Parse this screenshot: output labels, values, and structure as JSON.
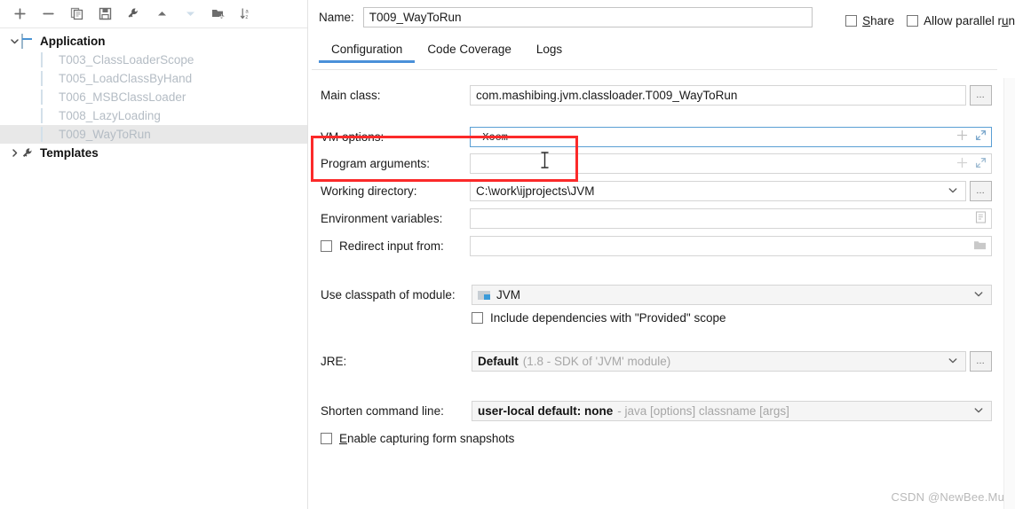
{
  "sidebar": {
    "toolbar": [
      {
        "name": "add-configuration-button",
        "icon": "plus-icon",
        "label": "+",
        "enabled": true
      },
      {
        "name": "remove-configuration-button",
        "icon": "minus-icon",
        "label": "−",
        "enabled": true
      },
      {
        "name": "copy-configuration-button",
        "icon": "copy-icon",
        "label": "Copy",
        "enabled": true
      },
      {
        "name": "save-configuration-button",
        "icon": "save-icon",
        "label": "Save",
        "enabled": true
      },
      {
        "name": "edit-templates-button",
        "icon": "wrench-icon",
        "label": "Edit Templates",
        "enabled": true
      },
      {
        "name": "move-up-button",
        "icon": "arrow-up-icon",
        "label": "Move Up",
        "enabled": true
      },
      {
        "name": "move-down-button",
        "icon": "arrow-down-icon",
        "label": "Move Down",
        "enabled": false
      },
      {
        "name": "new-folder-button",
        "icon": "folder-add-icon",
        "label": "New Folder",
        "enabled": true
      },
      {
        "name": "sort-configurations-button",
        "icon": "sort-alpha-icon",
        "label": "Sort",
        "enabled": true
      }
    ],
    "tree": [
      {
        "label": "Application",
        "icon": "application-icon",
        "twisty": "chevron-down-icon",
        "level": 0,
        "bold": true,
        "selected": false
      },
      {
        "label": "T003_ClassLoaderScope",
        "icon": "application-icon",
        "twisty": "",
        "level": 1,
        "bold": false,
        "selected": false
      },
      {
        "label": "T005_LoadClassByHand",
        "icon": "application-icon",
        "twisty": "",
        "level": 1,
        "bold": false,
        "selected": false
      },
      {
        "label": "T006_MSBClassLoader",
        "icon": "application-icon",
        "twisty": "",
        "level": 1,
        "bold": false,
        "selected": false
      },
      {
        "label": "T008_LazyLoading",
        "icon": "application-icon",
        "twisty": "",
        "level": 1,
        "bold": false,
        "selected": false
      },
      {
        "label": "T009_WayToRun",
        "icon": "application-icon",
        "twisty": "",
        "level": 1,
        "bold": false,
        "selected": true
      },
      {
        "label": "Templates",
        "icon": "wrench-icon",
        "twisty": "chevron-right-icon",
        "level": 0,
        "bold": true,
        "selected": false
      }
    ]
  },
  "header": {
    "name_label": "Name:",
    "name_value": "T009_WayToRun",
    "share_label_pre": "",
    "share_label_mn": "S",
    "share_label_post": "hare",
    "share_checked": false,
    "parallel_label_pre": "Allow parallel r",
    "parallel_label_mn": "u",
    "parallel_label_post": "n",
    "parallel_checked": false
  },
  "tabs": [
    {
      "label": "Configuration",
      "active": true
    },
    {
      "label": "Code Coverage",
      "active": false
    },
    {
      "label": "Logs",
      "active": false
    }
  ],
  "form": {
    "main_class": {
      "label": "Main class:",
      "value": "com.mashibing.jvm.classloader.T009_WayToRun",
      "browse_label": "…"
    },
    "vm_options": {
      "label": "VM options:",
      "value": "-Xcom",
      "focused": true,
      "expand_icon": "expand-icon",
      "add_icon": "plus-icon"
    },
    "program_arguments": {
      "label": "Program arguments:",
      "value": "",
      "expand_icon": "expand-icon",
      "add_icon": "plus-icon"
    },
    "working_directory": {
      "label": "Working directory:",
      "value": "C:\\work\\ijprojects\\JVM",
      "dropdown_icon": "chevron-down-icon",
      "browse_label": "…"
    },
    "environment_variables": {
      "label": "Environment variables:",
      "value": "",
      "icon": "list-icon"
    },
    "redirect_input": {
      "label": "Redirect input from:",
      "checked": false,
      "value": "",
      "icon": "folder-icon"
    },
    "classpath_module": {
      "label": "Use classpath of module:",
      "value": "JVM",
      "module_icon": "module-icon",
      "dropdown_icon": "chevron-down-icon"
    },
    "include_provided": {
      "label": "Include dependencies with \"Provided\" scope",
      "checked": false
    },
    "jre": {
      "label": "JRE:",
      "value_strong": "Default",
      "value_gray": "(1.8 - SDK of 'JVM' module)",
      "dropdown_icon": "chevron-down-icon",
      "browse_label": "…"
    },
    "shorten_command_line": {
      "label": "Shorten command line:",
      "value_strong": "user-local default: none",
      "value_gray": "- java [options] classname [args]",
      "dropdown_icon": "chevron-down-icon"
    },
    "form_snapshots": {
      "label_pre": "",
      "label_mn": "E",
      "label_post": "nable capturing form snapshots",
      "checked": false
    }
  },
  "annotation": {
    "name": "vm-options-highlight",
    "color": "#fb2a2a"
  },
  "watermark": "CSDN @NewBee.Mu"
}
